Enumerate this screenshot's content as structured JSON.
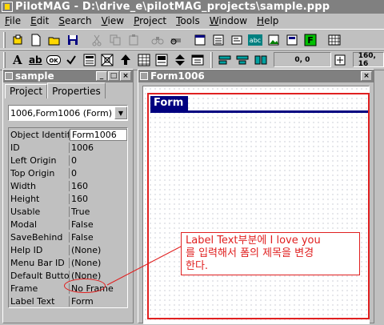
{
  "app": {
    "title": "PilotMAG - D:\\drive_e\\pilotMAG_projects\\sample.ppp"
  },
  "menu": [
    {
      "label": "File",
      "u": "F",
      "rest": "ile"
    },
    {
      "label": "Edit",
      "u": "E",
      "rest": "dit"
    },
    {
      "label": "Search",
      "u": "S",
      "rest": "earch"
    },
    {
      "label": "View",
      "u": "V",
      "rest": "iew"
    },
    {
      "label": "Project",
      "u": "P",
      "rest": "roject"
    },
    {
      "label": "Tools",
      "u": "T",
      "rest": "ools"
    },
    {
      "label": "Window",
      "u": "W",
      "rest": "indow"
    },
    {
      "label": "Help",
      "u": "H",
      "rest": "elp"
    }
  ],
  "toolbar2": {
    "text_tool": "A",
    "ab_tool": "ab",
    "ok_tool": "OK",
    "coords": "0, 0",
    "size": "160, 16"
  },
  "toolbar1": {
    "abc_label": "abc",
    "f_label": "F"
  },
  "project_panel": {
    "title": "sample",
    "tabs": [
      "Project",
      "Properties"
    ],
    "active_tab": "Properties",
    "selector": "1006,Form1006 (Form)",
    "properties": [
      {
        "name": "Object Identifie",
        "value": "Form1006",
        "editing": true
      },
      {
        "name": "ID",
        "value": "1006"
      },
      {
        "name": "Left Origin",
        "value": "0"
      },
      {
        "name": "Top Origin",
        "value": "0"
      },
      {
        "name": "Width",
        "value": "160"
      },
      {
        "name": "Height",
        "value": "160"
      },
      {
        "name": "Usable",
        "value": "True"
      },
      {
        "name": "Modal",
        "value": "False"
      },
      {
        "name": "SaveBehind",
        "value": "False"
      },
      {
        "name": "Help ID",
        "value": "(None)"
      },
      {
        "name": "Menu Bar ID",
        "value": "(None)"
      },
      {
        "name": "Default Button",
        "value": "(None)"
      },
      {
        "name": "Frame",
        "value": "No Frame"
      },
      {
        "name": "Label Text",
        "value": "Form"
      }
    ]
  },
  "form_window": {
    "title": "Form1006",
    "form_title": "Form"
  },
  "annotation": {
    "lines": [
      "Label Text부분에 I love you",
      "를 입력해서 폼의 제목을 변경",
      "한다."
    ]
  },
  "colors": {
    "accent": "#e02020",
    "form_title_bg": "#000080"
  }
}
